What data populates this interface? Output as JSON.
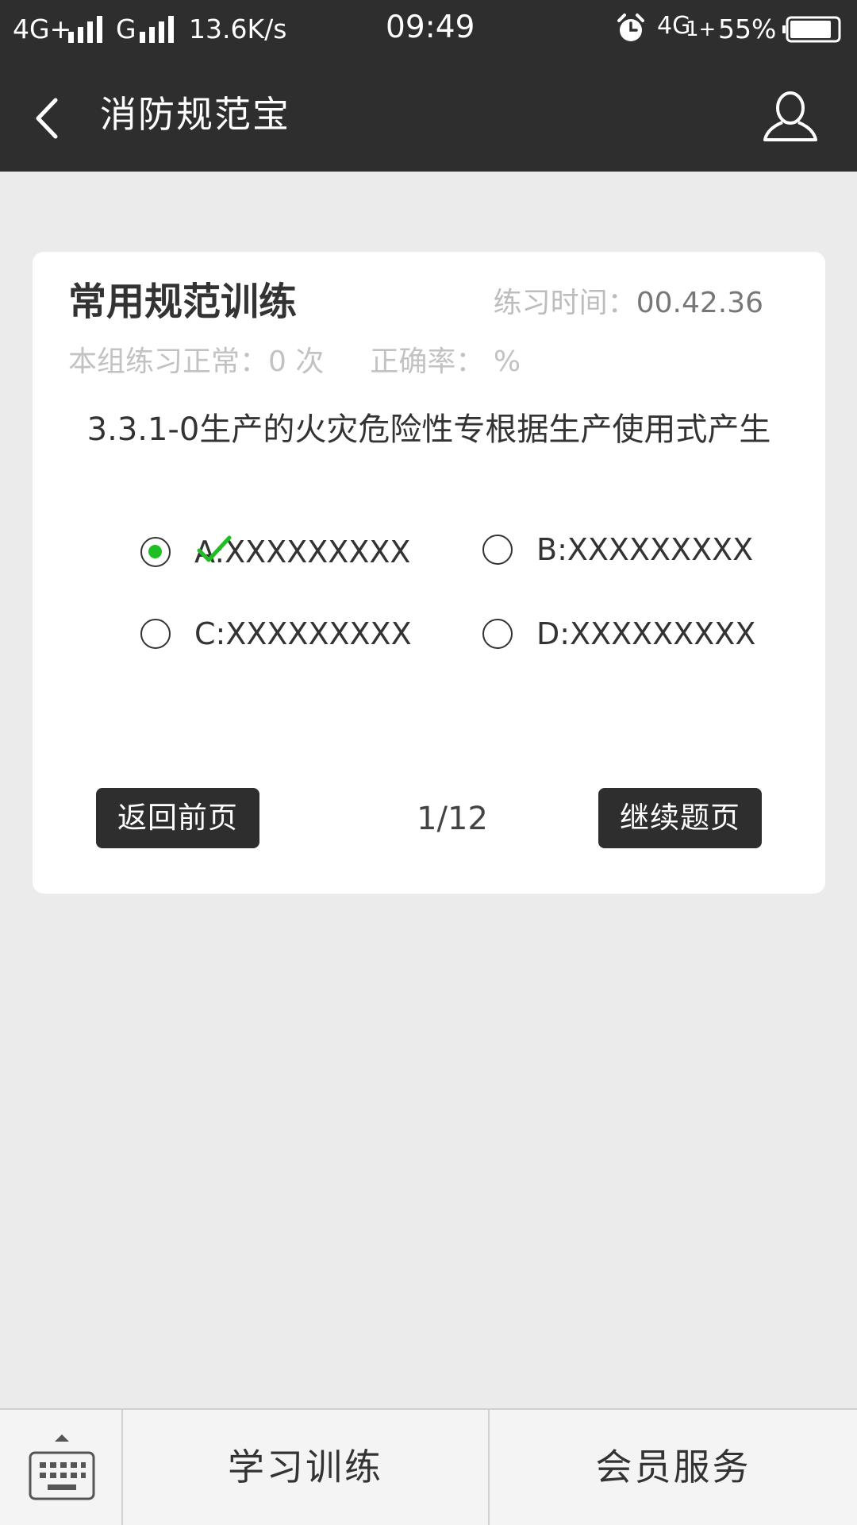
{
  "status_bar": {
    "network1": "4G+",
    "network2": "G",
    "speed": "13.6K/s",
    "time": "09:49",
    "network3": "4G",
    "network3_suffix": "1+",
    "battery": "55%",
    "battery_level": 0.55,
    "icons": [
      "signal-icon",
      "alarm-icon",
      "battery-icon"
    ]
  },
  "header": {
    "title": "消防规范宝",
    "icons": [
      "back-arrow-icon",
      "user-icon"
    ]
  },
  "card": {
    "title": "常用规范训练",
    "time_label": "练习时间：",
    "time_value": "00.42.36",
    "stats_label": "本组练习正常：",
    "stats_count": "0",
    "stats_unit": "次",
    "accuracy_label": "正确率：",
    "accuracy_value": "%",
    "question": "3.3.1-0生产的火灾危险性专根据生产使用式产生",
    "options": [
      {
        "label": "A:XXXXXXXXX",
        "selected": true,
        "correct": true
      },
      {
        "label": "B:XXXXXXXXX",
        "selected": false
      },
      {
        "label": "C:XXXXXXXXX",
        "selected": false
      },
      {
        "label": "D:XXXXXXXXX",
        "selected": false
      }
    ],
    "prev_button": "返回前页",
    "next_button": "继续题页",
    "page_indicator": "1/12"
  },
  "bottom_nav": {
    "tabs": [
      "学习训练",
      "会员服务"
    ],
    "icons": [
      "keyboard-icon",
      "chevron-up-icon"
    ]
  },
  "colors": {
    "header_bg": "#2e2e2e",
    "page_bg": "#ebebeb",
    "accent_green": "#1dbf22"
  }
}
